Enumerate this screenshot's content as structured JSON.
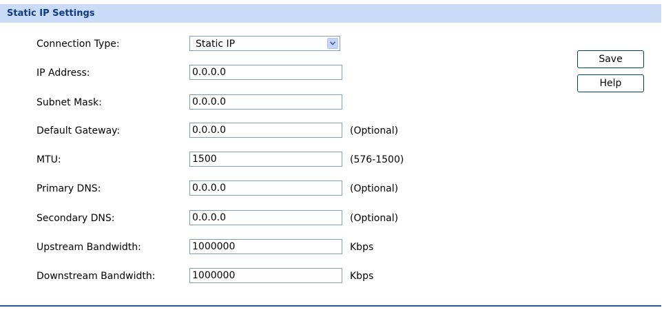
{
  "header": {
    "title": "Static IP Settings"
  },
  "form": {
    "connection_type": {
      "label": "Connection Type:",
      "value": "Static IP"
    },
    "fields": [
      {
        "label": "IP Address:",
        "value": "0.0.0.0",
        "hint": ""
      },
      {
        "label": "Subnet Mask:",
        "value": "0.0.0.0",
        "hint": ""
      },
      {
        "label": "Default Gateway:",
        "value": "0.0.0.0",
        "hint": "(Optional)"
      },
      {
        "label": "MTU:",
        "value": "1500",
        "hint": "(576-1500)"
      },
      {
        "label": "Primary DNS:",
        "value": "0.0.0.0",
        "hint": "(Optional)"
      },
      {
        "label": "Secondary DNS:",
        "value": "0.0.0.0",
        "hint": "(Optional)"
      },
      {
        "label": "Upstream Bandwidth:",
        "value": "1000000",
        "hint": "Kbps"
      },
      {
        "label": "Downstream Bandwidth:",
        "value": "1000000",
        "hint": "Kbps"
      }
    ]
  },
  "buttons": {
    "save_label": "Save",
    "help_label": "Help"
  },
  "icons": {
    "dropdown": "chevron-down-icon"
  },
  "colors": {
    "header_bg": "#c9dbf6",
    "header_text": "#0d3a82",
    "footer_line": "#1c5aa6",
    "input_border": "#7f9db9"
  }
}
